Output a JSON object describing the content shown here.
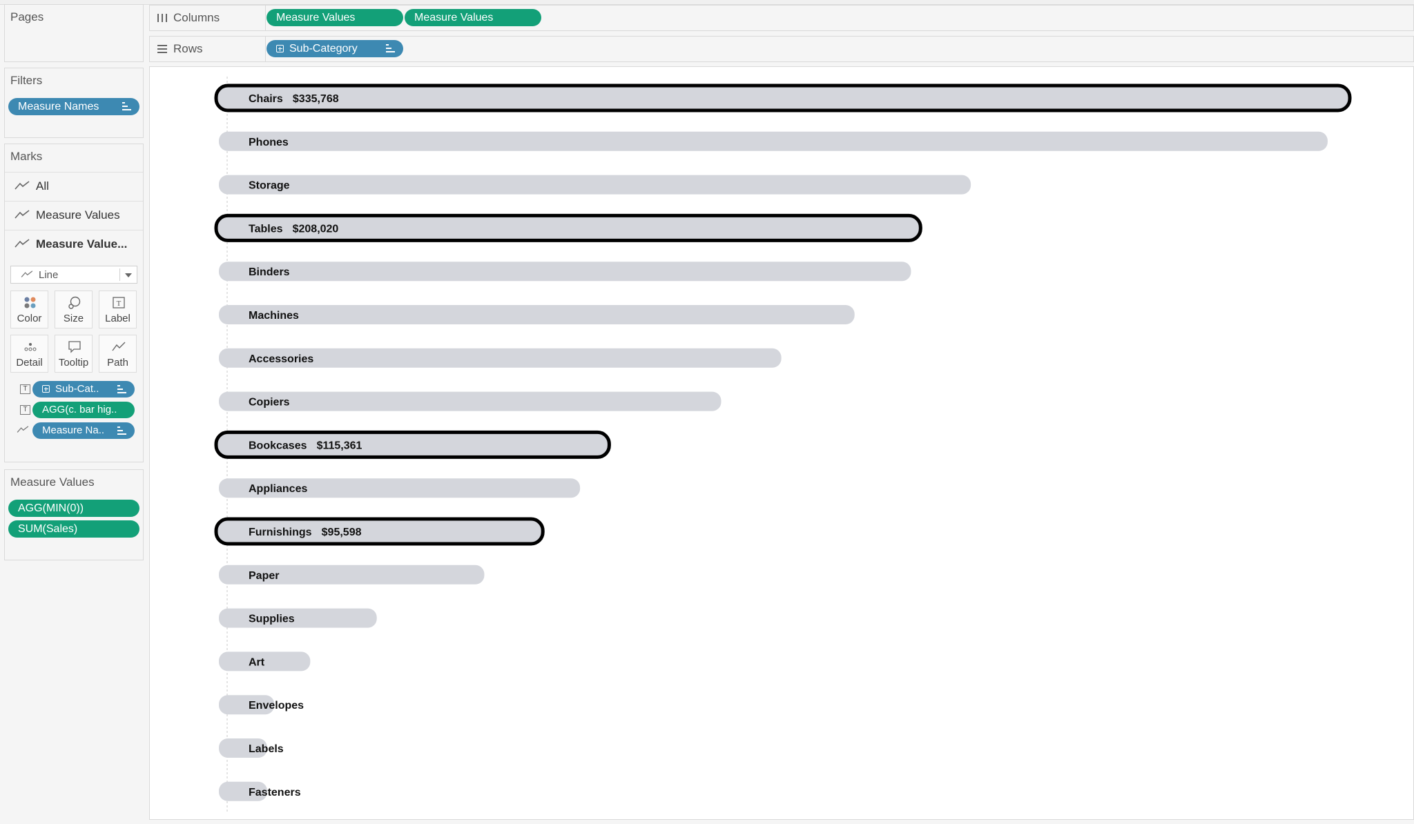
{
  "left_panel": {
    "pages_title": "Pages",
    "filters_title": "Filters",
    "filters": [
      {
        "label": "Measure Names",
        "color": "#3d89b2"
      }
    ],
    "marks_title": "Marks",
    "marks_layers": [
      {
        "label": "All",
        "icon": "line-chart-icon",
        "bold": false
      },
      {
        "label": "Measure Values",
        "icon": "line-chart-icon",
        "bold": false
      },
      {
        "label": "Measure Value...",
        "icon": "line-chart-icon",
        "bold": true
      }
    ],
    "mark_type": {
      "label": "Line",
      "icon": "line-chart-icon"
    },
    "mark_cards": [
      "Color",
      "Size",
      "Label",
      "Detail",
      "Tooltip",
      "Path"
    ],
    "encodings": [
      {
        "type_icon": "text-icon",
        "pill": "Sub-Cat..",
        "color": "#3d89b2"
      },
      {
        "type_icon": "text-icon",
        "pill": "AGG(c. bar hig..",
        "color": "#13a078"
      },
      {
        "type_icon": "path-icon",
        "pill": "Measure Na..",
        "color": "#3d89b2"
      }
    ],
    "measure_values_title": "Measure Values",
    "measure_values": [
      {
        "label": "AGG(MIN(0))",
        "color": "#13a078"
      },
      {
        "label": "SUM(Sales)",
        "color": "#13a078"
      }
    ]
  },
  "shelves": {
    "columns_label": "Columns",
    "columns_pills": [
      {
        "label": "Measure Values",
        "color": "#13a078"
      },
      {
        "label": "Measure Values",
        "color": "#13a078"
      }
    ],
    "rows_label": "Rows",
    "rows_pills": [
      {
        "label": "Sub-Category",
        "color": "#3d89b2"
      }
    ]
  },
  "chart_data": {
    "type": "bar",
    "orientation": "horizontal",
    "bar_style": "rounded-line",
    "bar_color": "#d4d6dc",
    "highlight_stroke": "#000000",
    "categories": [
      "Chairs",
      "Phones",
      "Storage",
      "Tables",
      "Binders",
      "Machines",
      "Accessories",
      "Copiers",
      "Bookcases",
      "Appliances",
      "Furnishings",
      "Paper",
      "Supplies",
      "Art",
      "Envelopes",
      "Labels",
      "Fasteners"
    ],
    "values": [
      335768,
      330000,
      223800,
      208020,
      206000,
      189200,
      167400,
      149500,
      115361,
      107500,
      95598,
      79000,
      47000,
      27200,
      16500,
      12500,
      3000
    ],
    "highlighted": [
      "Chairs",
      "Tables",
      "Bookcases",
      "Furnishings"
    ],
    "labels": {
      "Chairs": "$335,768",
      "Tables": "$208,020",
      "Bookcases": "$115,361",
      "Furnishings": "$95,598"
    },
    "xlim": [
      0,
      335768
    ],
    "grid": false
  }
}
